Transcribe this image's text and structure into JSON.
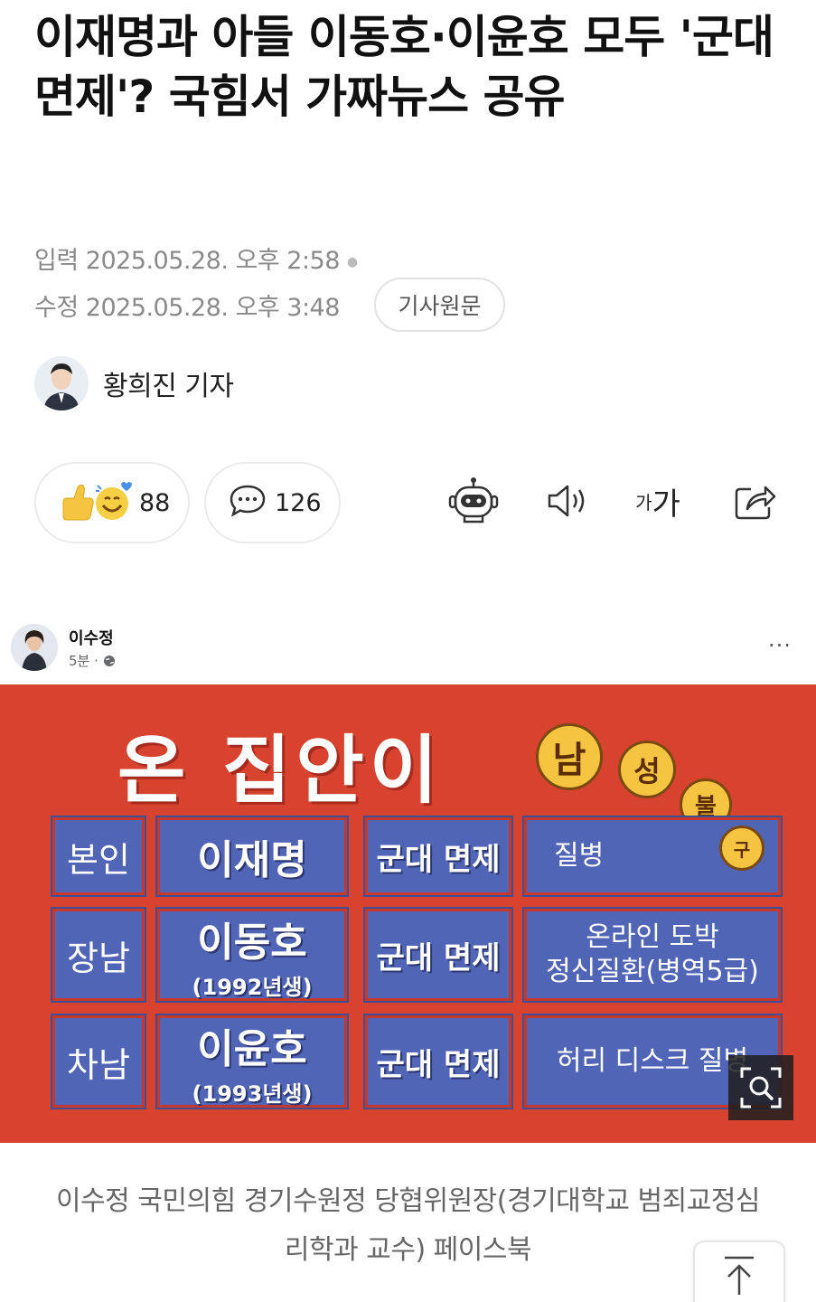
{
  "article": {
    "headline": "이재명과 아들 이동호·이윤호 모두 '군대면제'? 국힘서 가짜뉴스 공유",
    "published": "입력 2025.05.28. 오후 2:58",
    "modified": "수정 2025.05.28. 오후 3:48",
    "original_button": "기사원문",
    "reporter": "황희진 기자"
  },
  "actions": {
    "reaction_count": "88",
    "comment_count": "126",
    "font_label_small": "가",
    "font_label_big": "가",
    "icons": [
      "reaction-emoji-icon",
      "comment-bubble-icon",
      "robot-summary-icon",
      "speaker-icon",
      "share-icon"
    ]
  },
  "facebook_post": {
    "author": "이수정",
    "time": "5분 · ",
    "more": "···"
  },
  "poster": {
    "title": "온 집안이",
    "circles": [
      "남",
      "성",
      "불",
      "구"
    ],
    "rows": [
      {
        "relation": "본인",
        "name": "이재명",
        "birth": "",
        "status": "군대 면제",
        "reason_1": "질병",
        "reason_2": ""
      },
      {
        "relation": "장남",
        "name": "이동호",
        "birth": "(1992년생)",
        "status": "군대 면제",
        "reason_1": "온라인 도박",
        "reason_2": "정신질환(병역5급)"
      },
      {
        "relation": "차남",
        "name": "이윤호",
        "birth": "(1993년생)",
        "status": "군대 면제",
        "reason_1": "허리 디스크 질병",
        "reason_2": ""
      }
    ],
    "colors": {
      "background": "#d8432f",
      "cell": "#5165b6",
      "circle": "#f5c542"
    }
  },
  "caption": "이수정 국민의힘 경기수원정 당협위원장(경기대학교 범죄교정심리학과 교수) 페이스북"
}
